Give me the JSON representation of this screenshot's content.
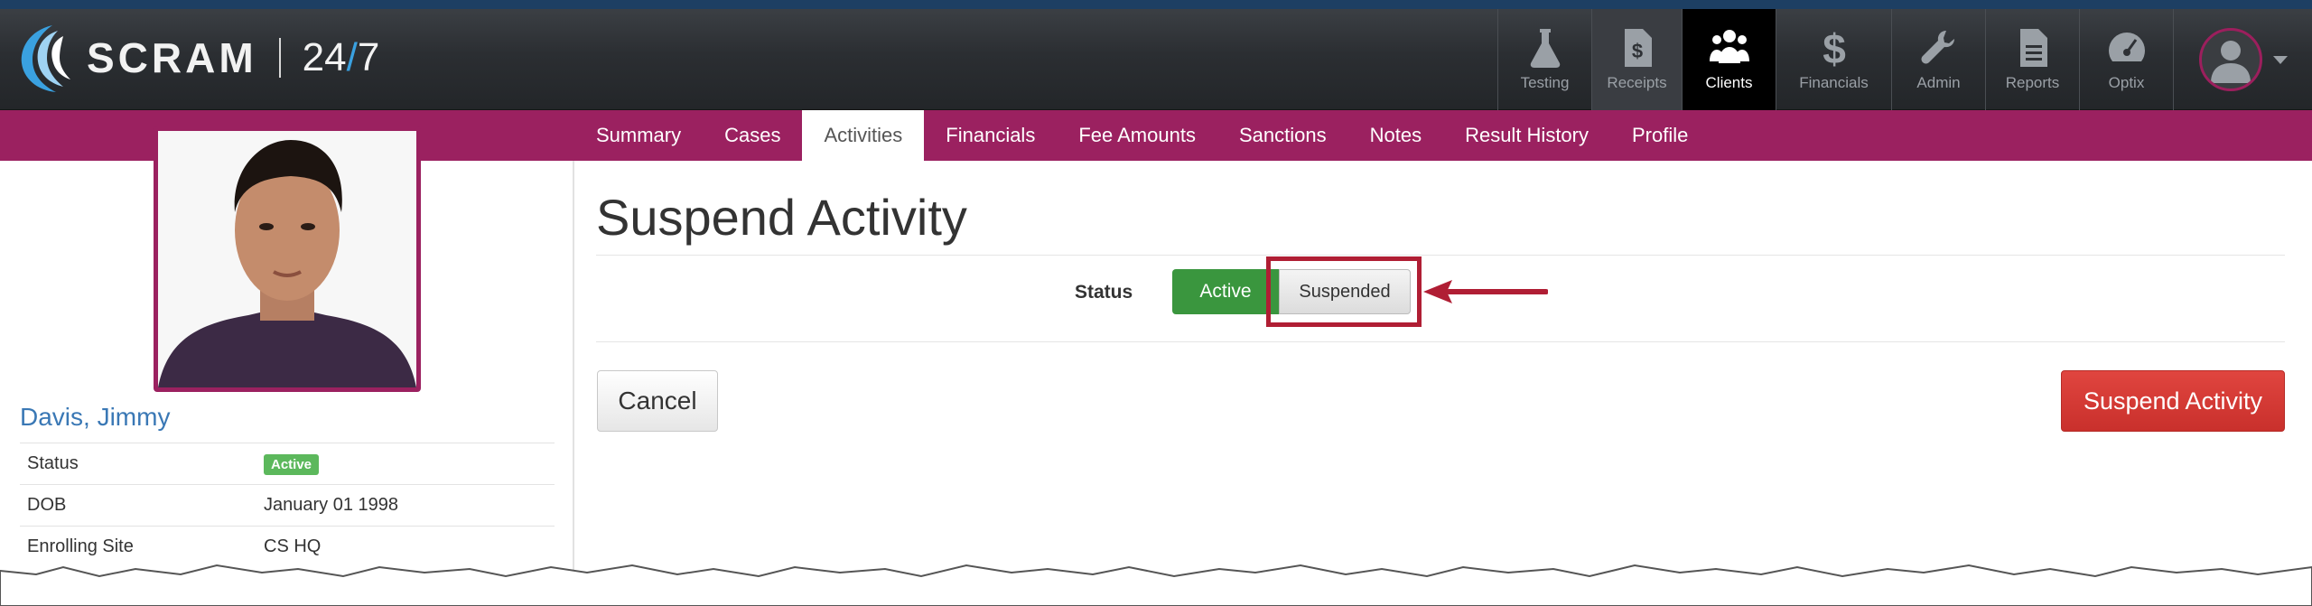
{
  "app": {
    "logo_text": "SCRAM",
    "logo_24": "24",
    "logo_slash": "/",
    "logo_7": "7"
  },
  "nav": {
    "items": [
      {
        "label": "Testing",
        "icon": "flask-icon"
      },
      {
        "label": "Receipts",
        "icon": "receipt-icon"
      },
      {
        "label": "Clients",
        "icon": "clients-icon",
        "active": true
      },
      {
        "label": "Financials",
        "icon": "dollar-icon"
      },
      {
        "label": "Admin",
        "icon": "wrench-icon"
      },
      {
        "label": "Reports",
        "icon": "document-icon"
      },
      {
        "label": "Optix",
        "icon": "gauge-icon"
      }
    ],
    "user_icon": "user-avatar-icon"
  },
  "tabs": [
    "Summary",
    "Cases",
    "Activities",
    "Financials",
    "Fee Amounts",
    "Sanctions",
    "Notes",
    "Result History",
    "Profile"
  ],
  "active_tab": "Activities",
  "client": {
    "name": "Davis, Jimmy",
    "rows": [
      {
        "label": "Status",
        "value": "Active"
      },
      {
        "label": "DOB",
        "value": "January 01 1998"
      },
      {
        "label": "Enrolling Site",
        "value": "CS HQ"
      }
    ]
  },
  "page": {
    "title": "Suspend Activity",
    "status_label": "Status",
    "status_options": [
      "Active",
      "Suspended"
    ],
    "selected_status": "Suspended",
    "cancel_label": "Cancel",
    "submit_label": "Suspend Activity"
  },
  "colors": {
    "brand_magenta": "#9b2160",
    "active_green": "#3a963e",
    "danger_red": "#d9534f",
    "annotation_red": "#b01e34",
    "link_blue": "#3a78b5"
  }
}
